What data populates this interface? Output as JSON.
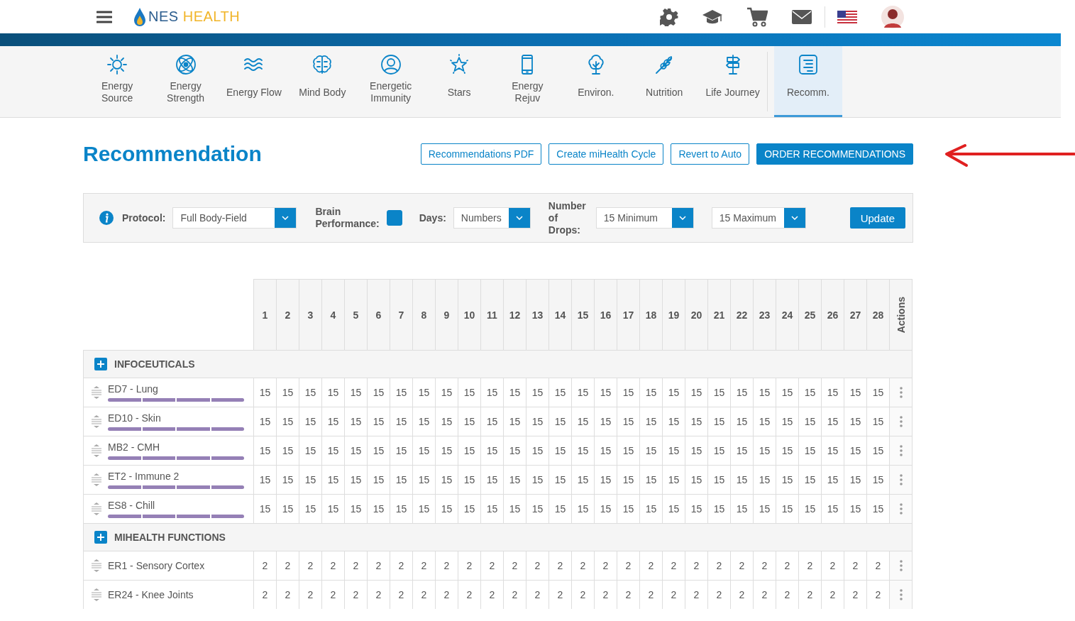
{
  "header": {
    "logo": {
      "part_1": "NES",
      "part_2": "HEALTH"
    }
  },
  "nav": [
    {
      "label": "Energy\nSource",
      "selected": false
    },
    {
      "label": "Energy\nStrength",
      "selected": false
    },
    {
      "label": "Energy Flow",
      "selected": false
    },
    {
      "label": "Mind Body",
      "selected": false
    },
    {
      "label": "Energetic\nImmunity",
      "selected": false
    },
    {
      "label": "Stars",
      "selected": false
    },
    {
      "label": "Energy\nRejuv",
      "selected": false
    },
    {
      "label": "Environ.",
      "selected": false
    },
    {
      "label": "Nutrition",
      "selected": false
    },
    {
      "label": "Life Journey",
      "selected": false
    },
    {
      "label": "Recomm.",
      "selected": true
    }
  ],
  "title": "Recommendation",
  "actions": [
    {
      "label": "Recommendations PDF",
      "kind": "outline"
    },
    {
      "label": "Create miHealth Cycle",
      "kind": "outline"
    },
    {
      "label": "Revert to Auto",
      "kind": "outline"
    },
    {
      "label": "ORDER RECOMMENDATIONS",
      "kind": "primary"
    }
  ],
  "filters": {
    "protocol_label": "Protocol:",
    "protocol": "Full Body-Field",
    "brain_label": "Brain\nPerformance:",
    "brain_checked": true,
    "days_label": "Days:",
    "days": "Numbers",
    "drops_label": "Number\nof\nDrops:",
    "min": "15 Minimum",
    "max": "15 Maximum",
    "update": "Update"
  },
  "table": {
    "days": [
      "1",
      "2",
      "3",
      "4",
      "5",
      "6",
      "7",
      "8",
      "9",
      "10",
      "11",
      "12",
      "13",
      "14",
      "15",
      "16",
      "17",
      "18",
      "19",
      "20",
      "21",
      "22",
      "23",
      "24",
      "25",
      "26",
      "27",
      "28"
    ],
    "actions_label": "Actions",
    "sections": [
      {
        "title": "INFOCEUTICALS",
        "kind": "infoceuticals",
        "rows": [
          {
            "name": "ED7 - Lung",
            "weeks": [
              {
                "on": true
              },
              {
                "on": true
              },
              {
                "on": true
              },
              {
                "on": true
              }
            ],
            "values": [
              "15",
              "15",
              "15",
              "15",
              "15",
              "15",
              "15",
              "15",
              "15",
              "15",
              "15",
              "15",
              "15",
              "15",
              "15",
              "15",
              "15",
              "15",
              "15",
              "15",
              "15",
              "15",
              "15",
              "15",
              "15",
              "15",
              "15",
              "15"
            ]
          },
          {
            "name": "ED10 - Skin",
            "weeks": [
              {
                "on": true
              },
              {
                "on": true
              },
              {
                "on": true
              },
              {
                "on": true
              }
            ],
            "values": [
              "15",
              "15",
              "15",
              "15",
              "15",
              "15",
              "15",
              "15",
              "15",
              "15",
              "15",
              "15",
              "15",
              "15",
              "15",
              "15",
              "15",
              "15",
              "15",
              "15",
              "15",
              "15",
              "15",
              "15",
              "15",
              "15",
              "15",
              "15"
            ]
          },
          {
            "name": "MB2 - CMH",
            "weeks": [
              {
                "on": true
              },
              {
                "on": true
              },
              {
                "on": true
              },
              {
                "on": true
              }
            ],
            "values": [
              "15",
              "15",
              "15",
              "15",
              "15",
              "15",
              "15",
              "15",
              "15",
              "15",
              "15",
              "15",
              "15",
              "15",
              "15",
              "15",
              "15",
              "15",
              "15",
              "15",
              "15",
              "15",
              "15",
              "15",
              "15",
              "15",
              "15",
              "15"
            ]
          },
          {
            "name": "ET2 - Immune 2",
            "weeks": [
              {
                "on": true
              },
              {
                "on": true
              },
              {
                "on": true
              },
              {
                "on": true
              }
            ],
            "values": [
              "15",
              "15",
              "15",
              "15",
              "15",
              "15",
              "15",
              "15",
              "15",
              "15",
              "15",
              "15",
              "15",
              "15",
              "15",
              "15",
              "15",
              "15",
              "15",
              "15",
              "15",
              "15",
              "15",
              "15",
              "15",
              "15",
              "15",
              "15"
            ]
          },
          {
            "name": "ES8 - Chill",
            "weeks": [
              {
                "on": true
              },
              {
                "on": true
              },
              {
                "on": true
              },
              {
                "on": true
              }
            ],
            "values": [
              "15",
              "15",
              "15",
              "15",
              "15",
              "15",
              "15",
              "15",
              "15",
              "15",
              "15",
              "15",
              "15",
              "15",
              "15",
              "15",
              "15",
              "15",
              "15",
              "15",
              "15",
              "15",
              "15",
              "15",
              "15",
              "15",
              "15",
              "15"
            ]
          }
        ]
      },
      {
        "title": "MIHEALTH FUNCTIONS",
        "kind": "functions",
        "rows": [
          {
            "name": "ER1 - Sensory Cortex",
            "values": [
              "2",
              "2",
              "2",
              "2",
              "2",
              "2",
              "2",
              "2",
              "2",
              "2",
              "2",
              "2",
              "2",
              "2",
              "2",
              "2",
              "2",
              "2",
              "2",
              "2",
              "2",
              "2",
              "2",
              "2",
              "2",
              "2",
              "2",
              "2"
            ]
          },
          {
            "name": "ER24 - Knee Joints",
            "values": [
              "2",
              "2",
              "2",
              "2",
              "2",
              "2",
              "2",
              "2",
              "2",
              "2",
              "2",
              "2",
              "2",
              "2",
              "2",
              "2",
              "2",
              "2",
              "2",
              "2",
              "2",
              "2",
              "2",
              "2",
              "2",
              "2",
              "2",
              "2"
            ]
          }
        ]
      }
    ]
  }
}
